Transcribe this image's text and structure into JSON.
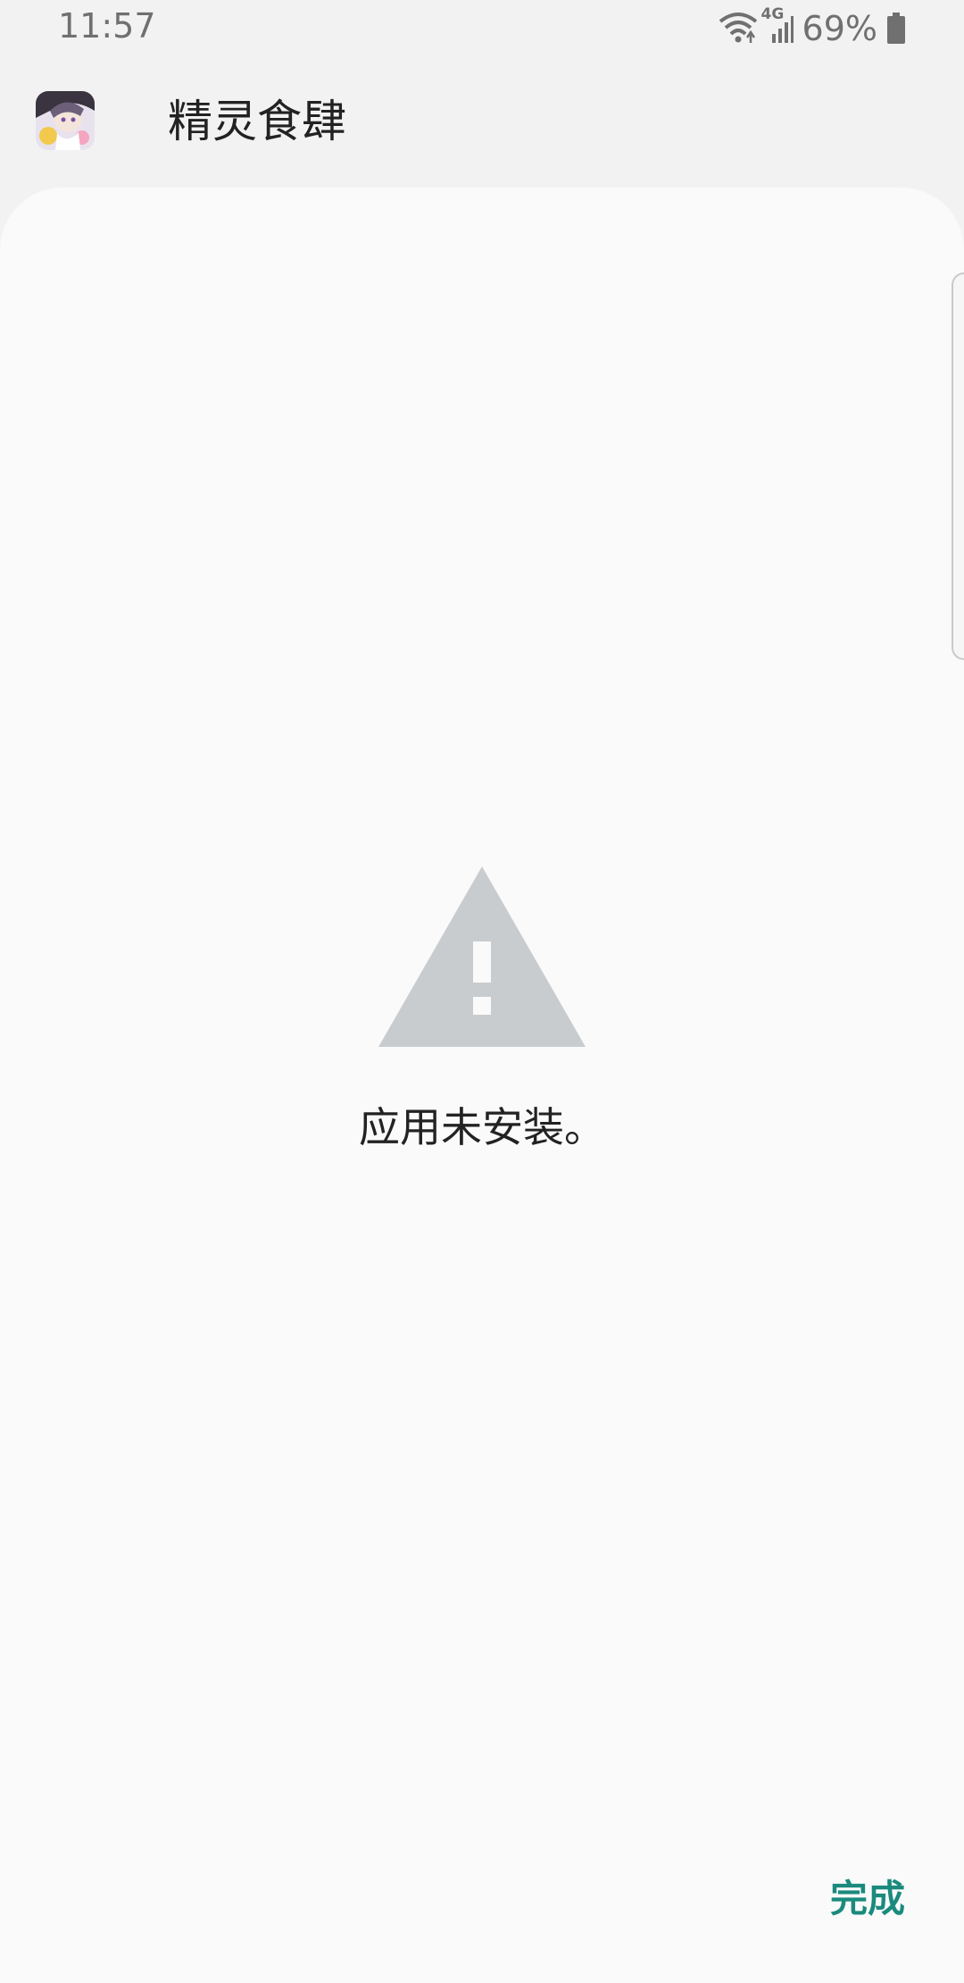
{
  "status_bar": {
    "time": "11:57",
    "network_type": "4G",
    "battery_percent": "69%",
    "icons": [
      "wifi-icon",
      "signal-icon",
      "battery-icon"
    ]
  },
  "header": {
    "app_name": "精灵食肆",
    "app_icon": "app-icon"
  },
  "content": {
    "icon": "warning-icon",
    "message": "应用未安装。"
  },
  "actions": {
    "done_label": "完成"
  },
  "colors": {
    "accent": "#1a8a7d",
    "background": "#fafafa",
    "header_background": "#f2f2f2",
    "warning_icon": "#c9cccf"
  }
}
